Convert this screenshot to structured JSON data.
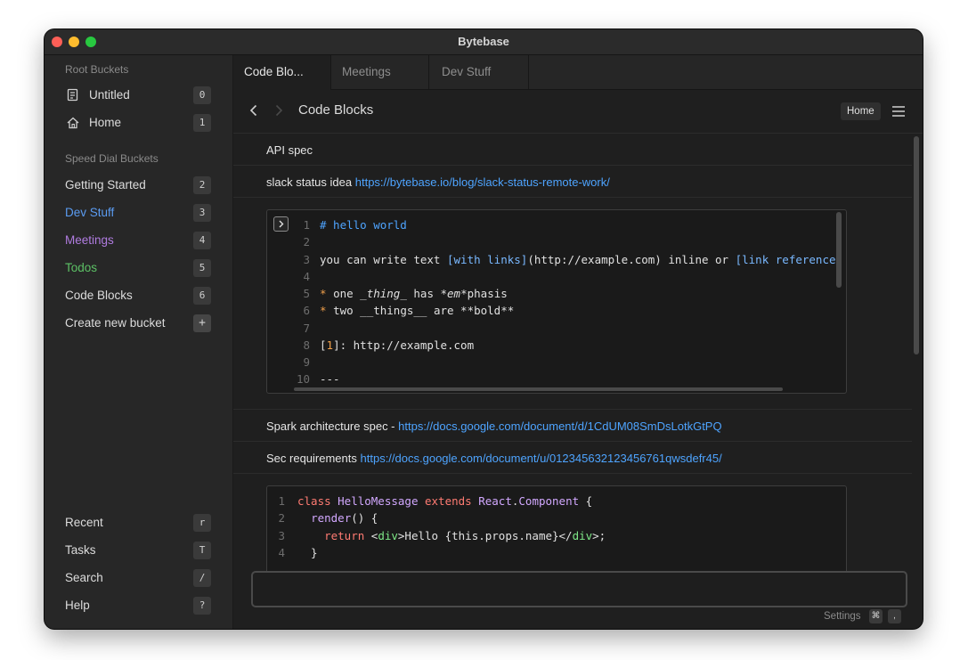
{
  "window": {
    "title": "Bytebase"
  },
  "sidebar": {
    "root_label": "Root Buckets",
    "root_items": [
      {
        "label": "Untitled",
        "badge": "0",
        "icon": "document-icon"
      },
      {
        "label": "Home",
        "badge": "1",
        "icon": "home-icon"
      }
    ],
    "speed_label": "Speed Dial Buckets",
    "speed_items": [
      {
        "label": "Getting Started",
        "badge": "2",
        "color": "#dcdcdc"
      },
      {
        "label": "Dev Stuff",
        "badge": "3",
        "color": "#5b9cf2"
      },
      {
        "label": "Meetings",
        "badge": "4",
        "color": "#b07ce0"
      },
      {
        "label": "Todos",
        "badge": "5",
        "color": "#5cc065"
      },
      {
        "label": "Code Blocks",
        "badge": "6",
        "color": "#dcdcdc"
      },
      {
        "label": "Create new bucket",
        "badge": "+",
        "color": "#dcdcdc"
      }
    ],
    "bottom_items": [
      {
        "label": "Recent",
        "badge": "r"
      },
      {
        "label": "Tasks",
        "badge": "T"
      },
      {
        "label": "Search",
        "badge": "/"
      },
      {
        "label": "Help",
        "badge": "?"
      }
    ]
  },
  "tabs": [
    {
      "label": "Code Blo..."
    },
    {
      "label": "Meetings"
    },
    {
      "label": "Dev Stuff"
    }
  ],
  "header": {
    "title": "Code Blocks",
    "home_chip": "Home",
    "back_icon": "chevron-left-icon",
    "forward_icon": "chevron-right-icon",
    "menu_icon": "hamburger-menu-icon"
  },
  "items": {
    "api_spec": "API spec",
    "slack_text": "slack status idea",
    "slack_link": "https://bytebase.io/blog/slack-status-remote-work/",
    "spark_text": "Spark architecture spec -",
    "spark_link": "https://docs.google.com/document/d/1CdUM08SmDsLotkGtPQ",
    "sec_text": "Sec requirements",
    "sec_link": "https://docs.google.com/document/u/012345632123456761qwsdefr45/"
  },
  "code1": {
    "lines": [
      "1",
      "2",
      "3",
      "4",
      "5",
      "6",
      "7",
      "8",
      "9",
      "10"
    ],
    "l1": "# hello world",
    "l3a": "you can write text ",
    "l3b": "[with links]",
    "l3c": "(http://example.com) inline or ",
    "l3d": "[link reference",
    "l5a": "* ",
    "l5b": "one _",
    "l5c": "thing",
    "l5d": "_ has *",
    "l5e": "em",
    "l5f": "*phasis",
    "l6a": "* ",
    "l6b": "two __things__ are **bold**",
    "l8a": "[",
    "l8b": "1",
    "l8c": "]: http://example.com",
    "l10": "---"
  },
  "code2": {
    "lines": [
      "1",
      "2",
      "3",
      "4"
    ],
    "l1a": "class ",
    "l1b": "HelloMessage ",
    "l1c": "extends ",
    "l1d": "React",
    "l1e": ".",
    "l1f": "Component",
    "l1g": " {",
    "l2a": "  ",
    "l2b": "render",
    "l2c": "() {",
    "l3a": "    ",
    "l3b": "return ",
    "l3c": "<",
    "l3d": "div",
    "l3e": ">Hello {this.props.name}</",
    "l3f": "div",
    "l3g": ">;",
    "l4": "  }"
  },
  "footer": {
    "settings": "Settings",
    "key1": "⌘",
    "key2": ","
  }
}
